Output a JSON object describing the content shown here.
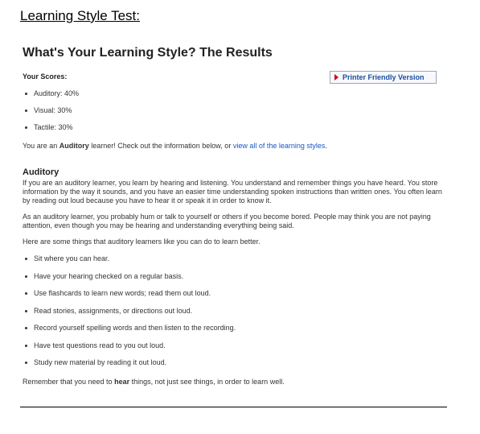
{
  "doc_heading": "Learning Style Test:",
  "title": "What's Your Learning Style? The Results",
  "scores_label": "Your Scores:",
  "printer_button": "Printer Friendly Version",
  "scores": [
    "Auditory: 40%",
    "Visual: 30%",
    "Tactile: 30%"
  ],
  "result": {
    "prefix": "You are an ",
    "style": "Auditory",
    "middle": " learner! Check out the information below, or ",
    "link": "view all of the learning styles",
    "suffix": "."
  },
  "section_title": "Auditory",
  "paragraphs": [
    "If you are an auditory learner, you learn by hearing and listening. You understand and remember things you have heard. You store information by the way it sounds, and you have an easier time understanding spoken instructions than written ones. You often learn by reading out loud because you have to hear it or speak it in order to know it.",
    "As an auditory learner, you probably hum or talk to yourself or others if you become bored. People may think you are not paying attention, even though you may be hearing and understanding everything being said.",
    "Here are some things that auditory learners like you can do to learn better."
  ],
  "tips": [
    "Sit where you can hear.",
    "Have your hearing checked on a regular basis.",
    "Use flashcards to learn new words; read them out loud.",
    "Read stories, assignments, or directions out loud.",
    "Record yourself spelling words and then listen to the recording.",
    "Have test questions read to you out loud.",
    "Study new material by reading it out loud."
  ],
  "closing": {
    "prefix": "Remember that you need to ",
    "emphasis": "hear",
    "suffix": " things, not just see things, in order to learn well."
  },
  "colors": {
    "link": "#1a56c4",
    "button_text": "#1a4fa0",
    "button_arrow": "#d0021b"
  }
}
